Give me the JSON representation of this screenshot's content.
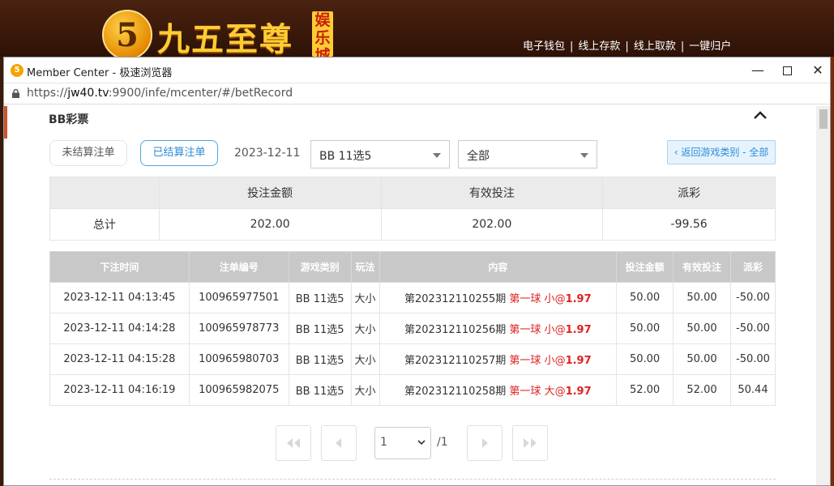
{
  "site": {
    "logo_char": "5",
    "logo_text": "九五至尊",
    "logo_tag": "娱乐城",
    "links": [
      "电子钱包",
      "线上存款",
      "线上取款",
      "一键归户"
    ],
    "link_sep": "|"
  },
  "window": {
    "app_icon": "5",
    "title": "Member Center - 极速浏览器",
    "url_prefix": "https://",
    "url_host": "jw40.tv",
    "url_rest": ":9900/infe/mcenter/#/betRecord"
  },
  "page": {
    "section_title": "BB彩票",
    "tab_unsettled": "未结算注单",
    "tab_settled": "已结算注单",
    "date": "2023-12-11",
    "game_select": "BB 11选5",
    "type_select": "全部",
    "back_button": "‹ 返回游戏类别 - 全部"
  },
  "summary": {
    "headers": [
      "",
      "投注金额",
      "有效投注",
      "派彩"
    ],
    "row": {
      "label": "总计",
      "bet": "202.00",
      "valid": "202.00",
      "payout": "-99.56"
    }
  },
  "records": {
    "headers": [
      "下注时间",
      "注单编号",
      "游戏类别",
      "玩法",
      "内容",
      "投注金额",
      "有效投注",
      "派彩"
    ],
    "rows": [
      {
        "time": "2023-12-11 04:13:45",
        "id": "100965977501",
        "game": "BB 11选5",
        "play": "大小",
        "period": "第202312110255期",
        "pick": "第一球 小",
        "at": "@",
        "odds": "1.97",
        "bet": "50.00",
        "valid": "50.00",
        "payout": "-50.00"
      },
      {
        "time": "2023-12-11 04:14:28",
        "id": "100965978773",
        "game": "BB 11选5",
        "play": "大小",
        "period": "第202312110256期",
        "pick": "第一球 小",
        "at": "@",
        "odds": "1.97",
        "bet": "50.00",
        "valid": "50.00",
        "payout": "-50.00"
      },
      {
        "time": "2023-12-11 04:15:28",
        "id": "100965980703",
        "game": "BB 11选5",
        "play": "大小",
        "period": "第202312110257期",
        "pick": "第一球 小",
        "at": "@",
        "odds": "1.97",
        "bet": "50.00",
        "valid": "50.00",
        "payout": "-50.00"
      },
      {
        "time": "2023-12-11 04:16:19",
        "id": "100965982075",
        "game": "BB 11选5",
        "play": "大小",
        "period": "第202312110258期",
        "pick": "第一球 大",
        "at": "@",
        "odds": "1.97",
        "bet": "52.00",
        "valid": "52.00",
        "payout": "50.44"
      }
    ]
  },
  "pagination": {
    "current": "1",
    "total": "/1"
  },
  "colors": {
    "accent": "#2a8ed8",
    "negative": "#e5383b",
    "highlight": "#e02020"
  },
  "icons": [
    "lock-icon",
    "chevron-up-icon",
    "first-page-icon",
    "prev-page-icon",
    "next-page-icon",
    "last-page-icon",
    "chevron-down-icon"
  ]
}
